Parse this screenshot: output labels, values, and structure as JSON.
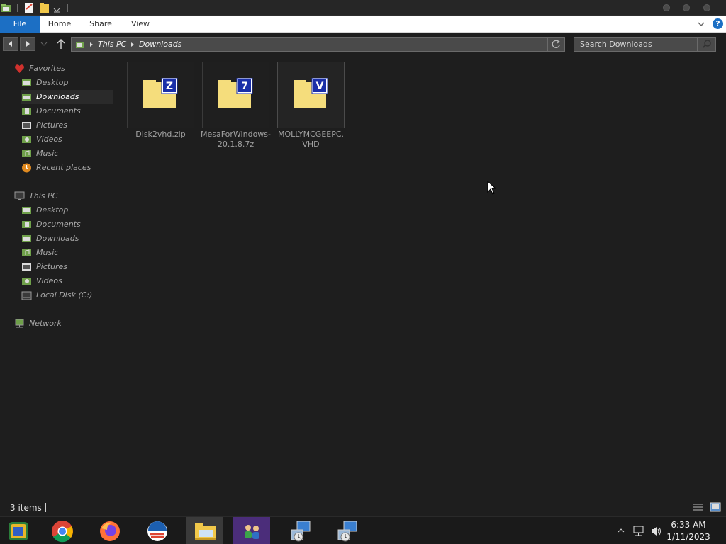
{
  "ribbon": {
    "tabs": [
      "File",
      "Home",
      "Share",
      "View"
    ],
    "help": "?"
  },
  "address": {
    "crumbs": [
      "This PC",
      "Downloads"
    ]
  },
  "search": {
    "placeholder": "Search Downloads"
  },
  "navpane": {
    "favorites": {
      "label": "Favorites",
      "items": [
        "Desktop",
        "Downloads",
        "Documents",
        "Pictures",
        "Videos",
        "Music",
        "Recent places"
      ]
    },
    "this_pc": {
      "label": "This PC",
      "items": [
        "Desktop",
        "Documents",
        "Downloads",
        "Music",
        "Pictures",
        "Videos",
        "Local Disk (C:)"
      ]
    },
    "network": {
      "label": "Network"
    }
  },
  "files": [
    {
      "name": "Disk2vhd.zip",
      "badge": "Z"
    },
    {
      "name": "MesaForWindows-20.1.8.7z",
      "badge": "7"
    },
    {
      "name": "MOLLYMCGEEPC.VHD",
      "badge": "V"
    }
  ],
  "status": {
    "item_count": "3 items"
  },
  "clock": {
    "time": "6:33 AM",
    "date": "1/11/2023"
  },
  "colors": {
    "accent": "#1c6fc4",
    "folder": "#f5dd7c",
    "badge": "#1a2fa8",
    "background": "#1e1e1e"
  }
}
